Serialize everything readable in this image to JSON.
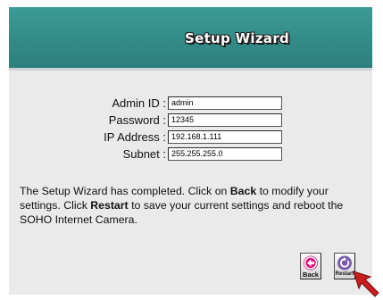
{
  "header": {
    "title": "Setup Wizard"
  },
  "form": {
    "rows": [
      {
        "label": "Admin ID :",
        "value": "admin"
      },
      {
        "label": "Password :",
        "value": "12345"
      },
      {
        "label": "IP Address :",
        "value": "192.168.1.111"
      },
      {
        "label": "Subnet :",
        "value": "255.255.255.0"
      }
    ]
  },
  "message": {
    "part1": "The Setup Wizard has completed.  Click on ",
    "back_word": "Back",
    "part2": " to modify your settings.  Click ",
    "restart_word": "Restart",
    "part3": " to save your current settings and reboot the SOHO Internet Camera."
  },
  "buttons": {
    "back_label": "Back",
    "restart_label": "Restart"
  },
  "icons": {
    "back": "back-arrow-icon",
    "restart": "restart-icon",
    "cursor": "mouse-pointer-icon"
  },
  "colors": {
    "header": "#2f8a86",
    "panel": "#eaeaea",
    "back_icon": "#e0137a",
    "restart_icon": "#7b5bb0",
    "cursor": "#c81e1e"
  }
}
